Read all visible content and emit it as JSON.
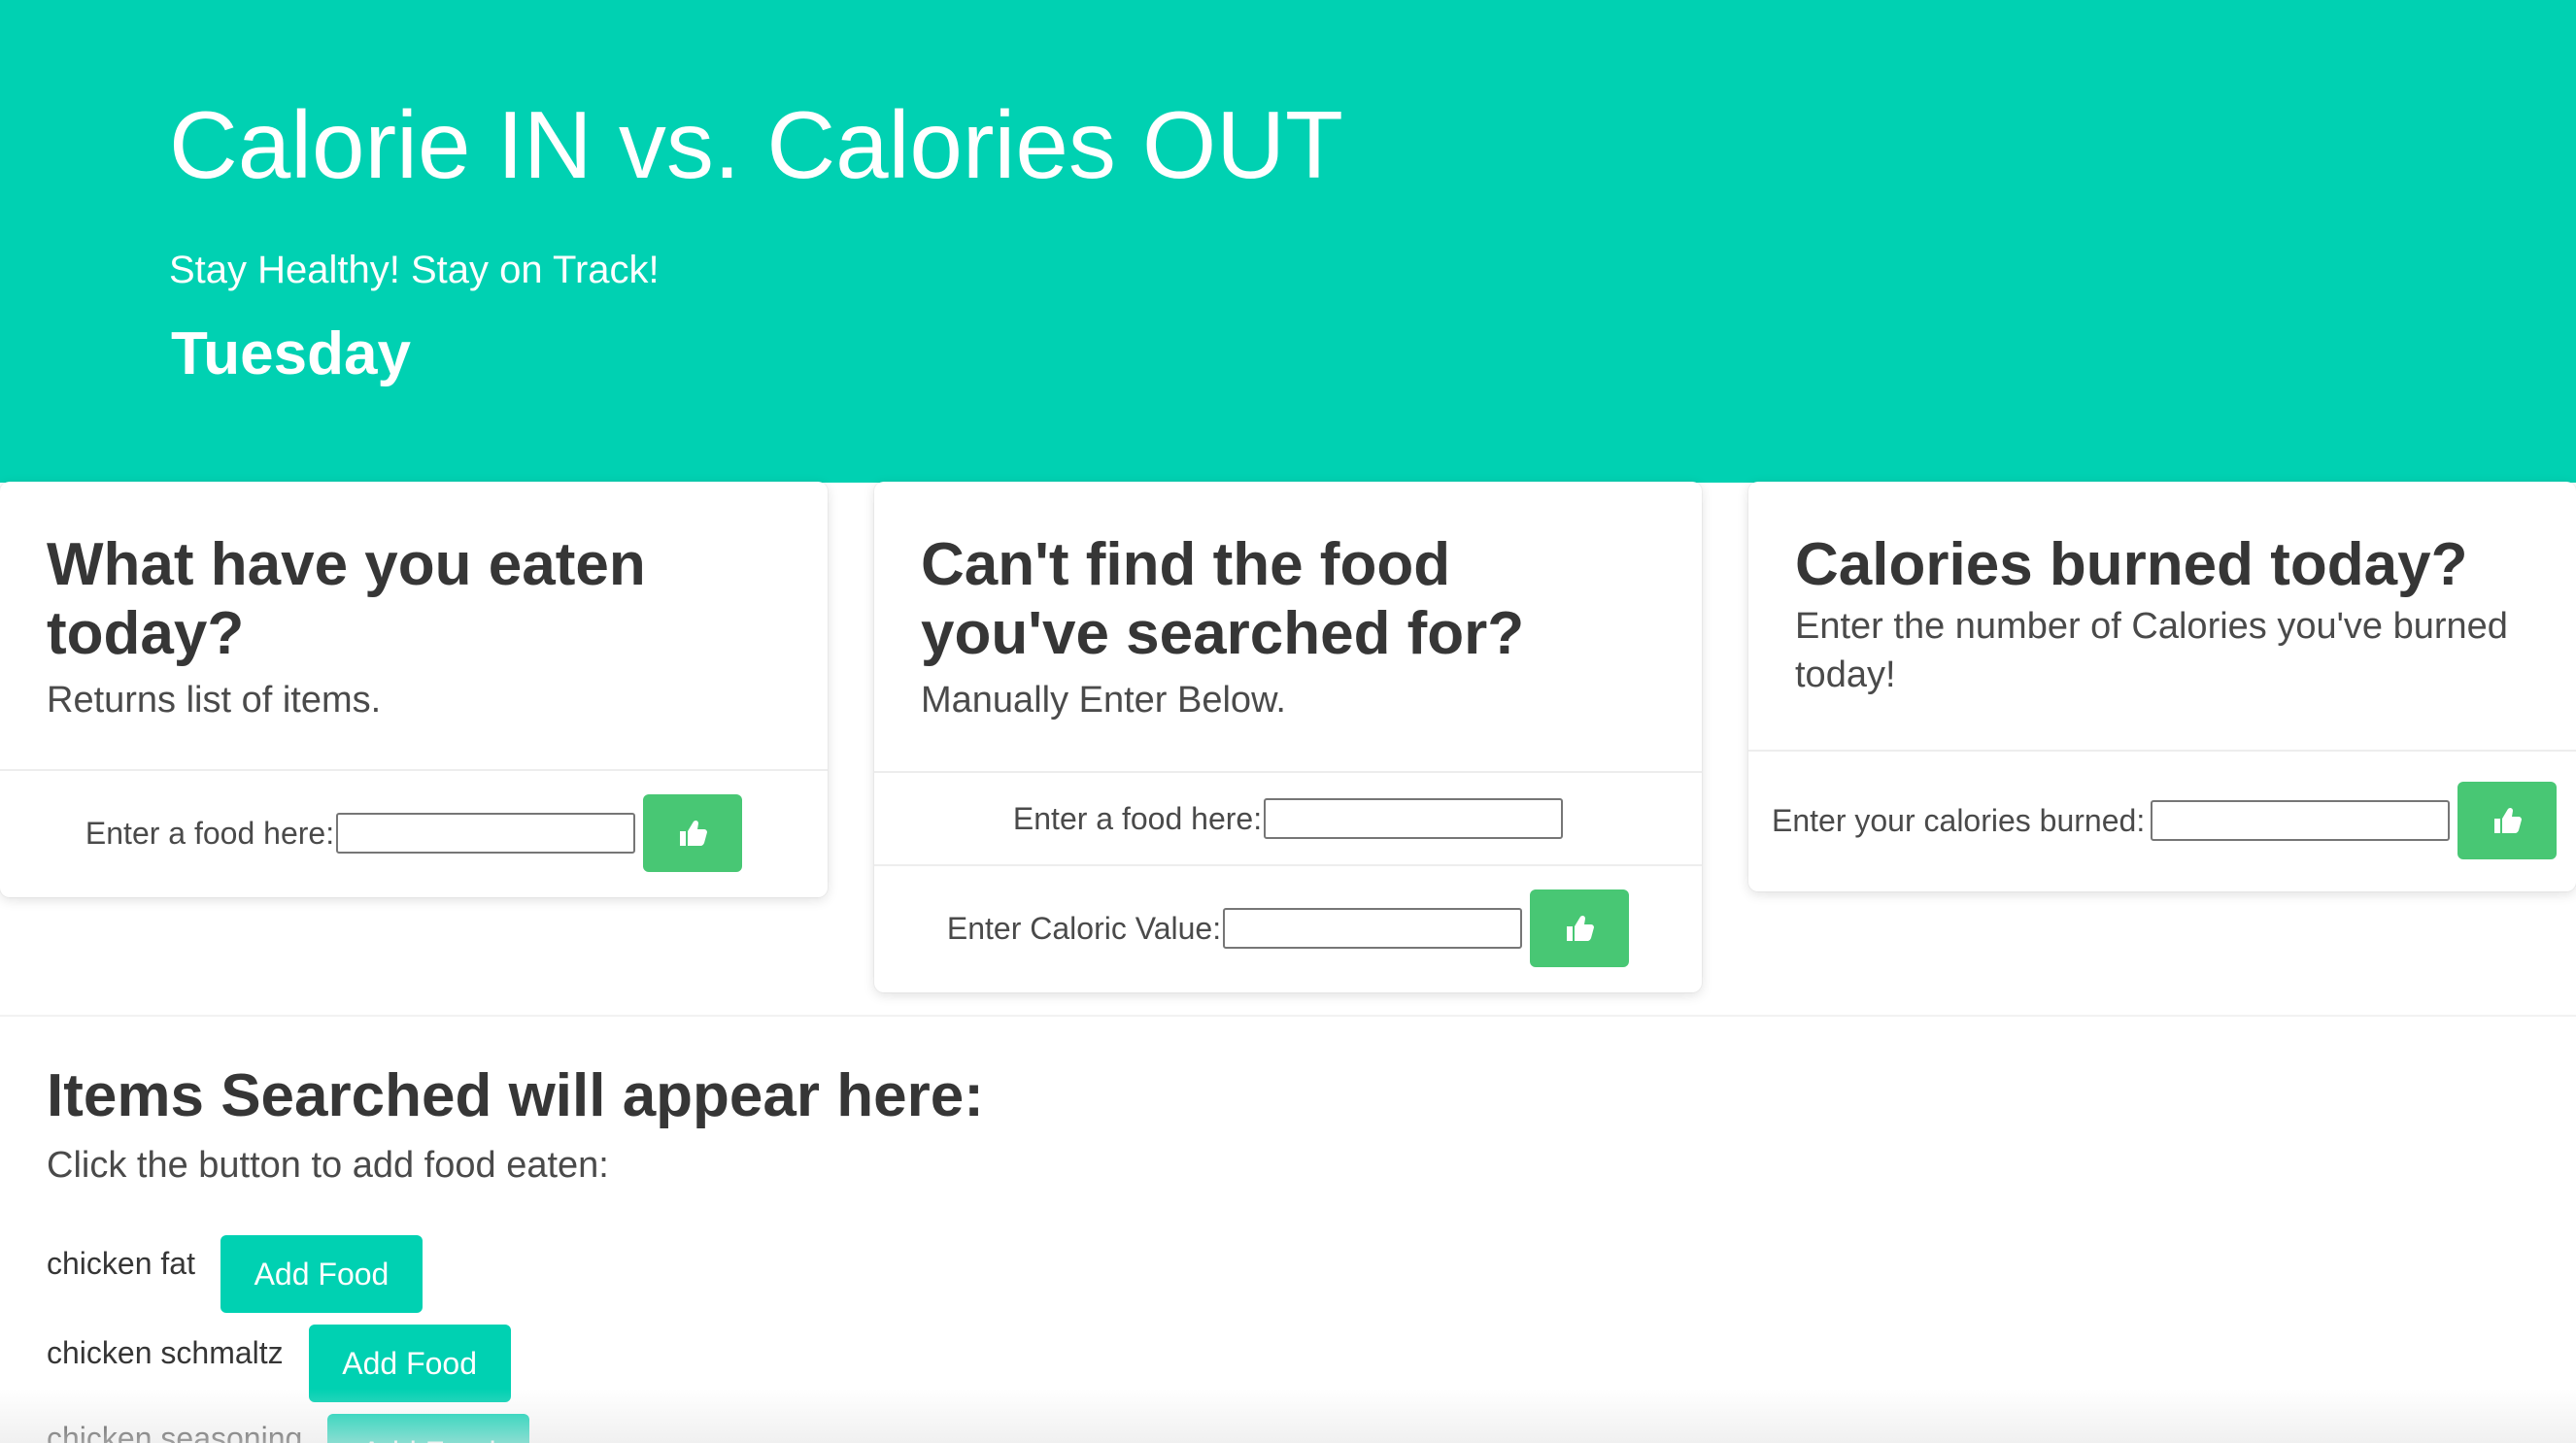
{
  "hero": {
    "title": "Calorie IN vs. Calories OUT",
    "subtitle": "Stay Healthy! Stay on Track!",
    "day": "Tuesday",
    "background_color": "#00d1b2"
  },
  "eaten_card": {
    "title": "What have you eaten today?",
    "subtitle": "Returns list of items.",
    "food_label": "Enter a food here:",
    "food_value": "",
    "submit_icon": "thumbs-up-icon"
  },
  "manual_card": {
    "title": "Can't find the food you've searched for?",
    "subtitle": "Manually Enter Below.",
    "food_label": "Enter a food here:",
    "food_value": "",
    "caloric_label": "Enter Caloric Value:",
    "caloric_value": "",
    "submit_icon": "thumbs-up-icon"
  },
  "burned_card": {
    "title": "Calories burned today?",
    "subtitle": "Enter the number of Calories you've burned today!",
    "calories_label": "Enter your calories burned:",
    "calories_value": "",
    "submit_icon": "thumbs-up-icon"
  },
  "results": {
    "title": "Items Searched will appear here:",
    "subtitle": "Click the button to add food eaten:",
    "items": [
      {
        "name": "chicken fat",
        "button_label": "Add Food"
      },
      {
        "name": "chicken schmaltz",
        "button_label": "Add Food"
      },
      {
        "name": "chicken seasoning",
        "button_label": "Add Food"
      }
    ]
  },
  "colors": {
    "primary": "#00d1b2",
    "success": "#48c774"
  }
}
